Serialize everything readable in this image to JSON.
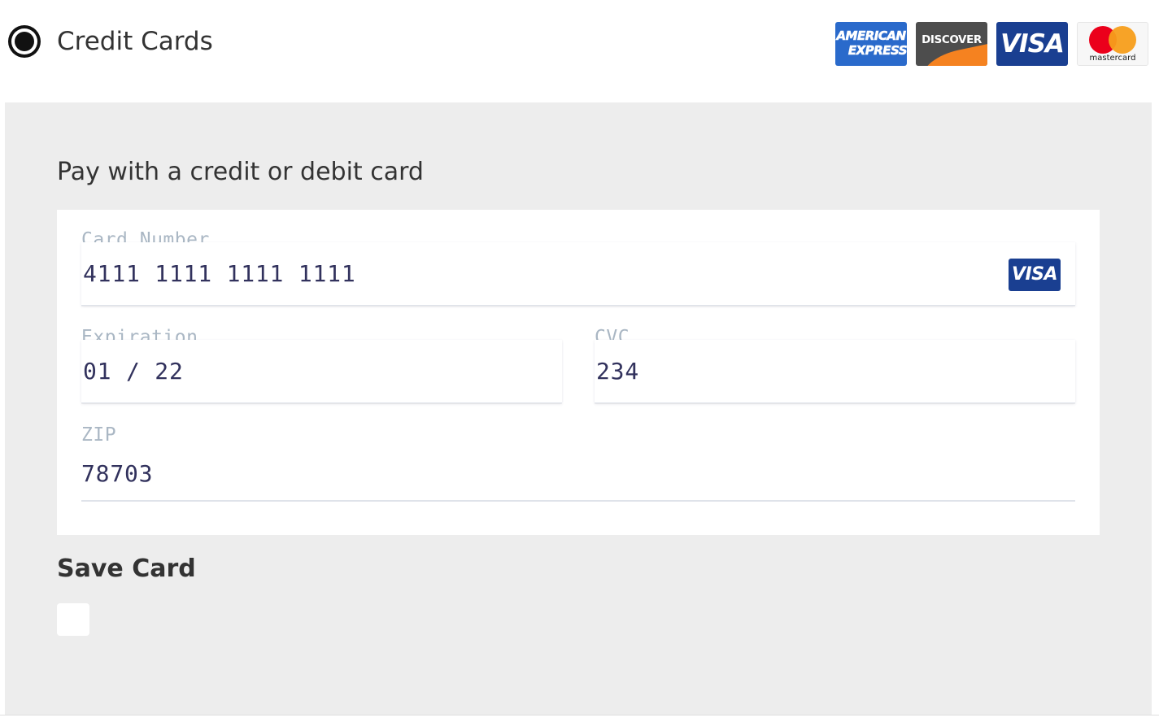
{
  "payment_method": {
    "title": "Credit Cards",
    "selected": true
  },
  "brands": {
    "amex_line1": "AMERICAN",
    "amex_line2": "EXPRESS",
    "discover": "DISCOVER",
    "visa": "VISA",
    "mastercard": "mastercard"
  },
  "card_panel": {
    "heading": "Pay with a credit or debit card",
    "card_number": {
      "label": "Card Number",
      "value": "4111 1111 1111 1111",
      "detected_brand": "VISA"
    },
    "expiration": {
      "label": "Expiration",
      "value": "01 / 22"
    },
    "cvc": {
      "label": "CVC",
      "value": "234"
    },
    "zip": {
      "label": "ZIP",
      "value": "78703"
    }
  },
  "save_card": {
    "label": "Save Card",
    "checked": false
  },
  "colors": {
    "panel_bg": "#ededed",
    "label_color": "#aab7c4",
    "value_color": "#32325d",
    "visa_blue": "#1a3f91",
    "amex_blue": "#2a6acb",
    "discover_gray": "#4d4d4d",
    "discover_orange": "#f58220"
  }
}
